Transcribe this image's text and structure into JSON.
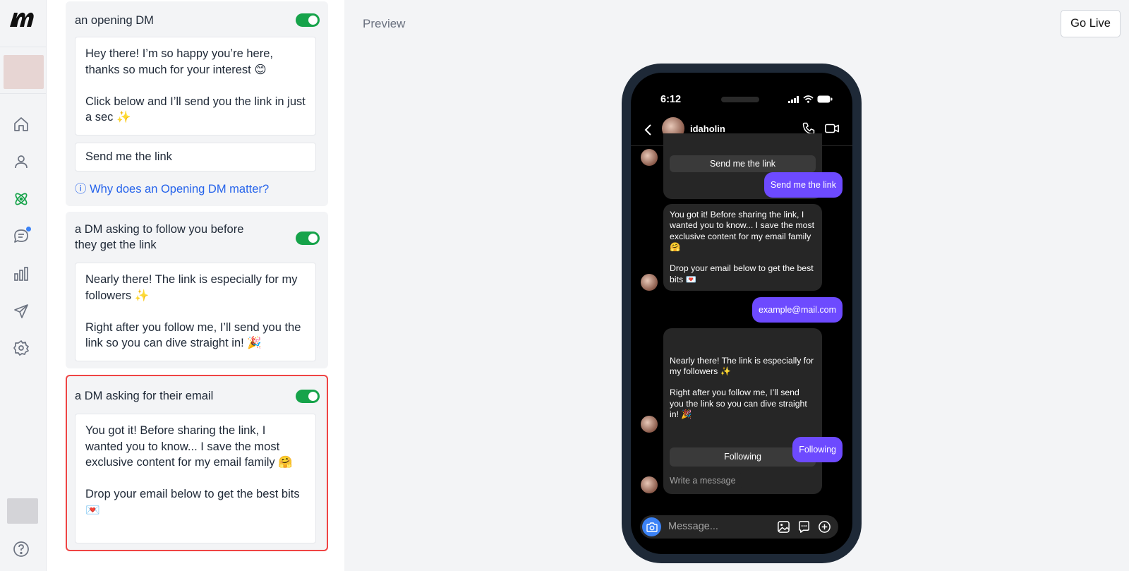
{
  "sidebar": {
    "logo_text": "m",
    "items": [
      {
        "name": "home-icon"
      },
      {
        "name": "user-icon"
      },
      {
        "name": "atom-icon",
        "active": true
      },
      {
        "name": "chat-icon",
        "notification": true
      },
      {
        "name": "bar-chart-icon"
      },
      {
        "name": "send-icon"
      },
      {
        "name": "gear-icon"
      }
    ],
    "help_icon": "help-icon"
  },
  "cards": {
    "opening": {
      "title": "an opening DM",
      "enabled": true,
      "message": "Hey there! I’m so happy you’re here, thanks so much for your interest 😊\n\nClick below and I’ll send you the link in just a sec ✨",
      "button_text": "Send me the link",
      "help_link": "ⓘ Why does an Opening DM matter?"
    },
    "follow": {
      "title": "a DM asking to follow you before they get the link",
      "enabled": true,
      "message": "Nearly there! The link is especially for my followers ✨\n\nRight after you follow me, I’ll send you the link so you can dive straight in! 🎉"
    },
    "email": {
      "title": "a DM asking for their email",
      "enabled": true,
      "message": "You got it! Before sharing the link, I wanted you to know... I save the most exclusive content for my email family 🤗\n\nDrop your email below to get the best bits 💌"
    }
  },
  "preview": {
    "label": "Preview",
    "go_live": "Go Live",
    "phone": {
      "time": "6:12",
      "username": "idaholin",
      "top_button": "Send me the link",
      "out_1": "Send me the link",
      "in_email": "You got it! Before sharing the link, I wanted you to know... I save the most exclusive content for my email family 🤗\n\nDrop your email below to get the best bits 💌",
      "out_2": "example@mail.com",
      "in_follow": "Nearly there! The link is especially for my followers ✨\n\nRight after you follow me, I’ll send you the link so you can dive straight in! 🎉",
      "follow_button": "Following",
      "out_3": "Following",
      "typing": "Write a message",
      "composer_placeholder": "Message..."
    }
  },
  "colors": {
    "toggle_on": "#16a34a",
    "selected_border": "#ef4444",
    "link": "#2563eb",
    "outgoing_bubble": "#6d4aff",
    "incoming_bubble": "#262626"
  }
}
